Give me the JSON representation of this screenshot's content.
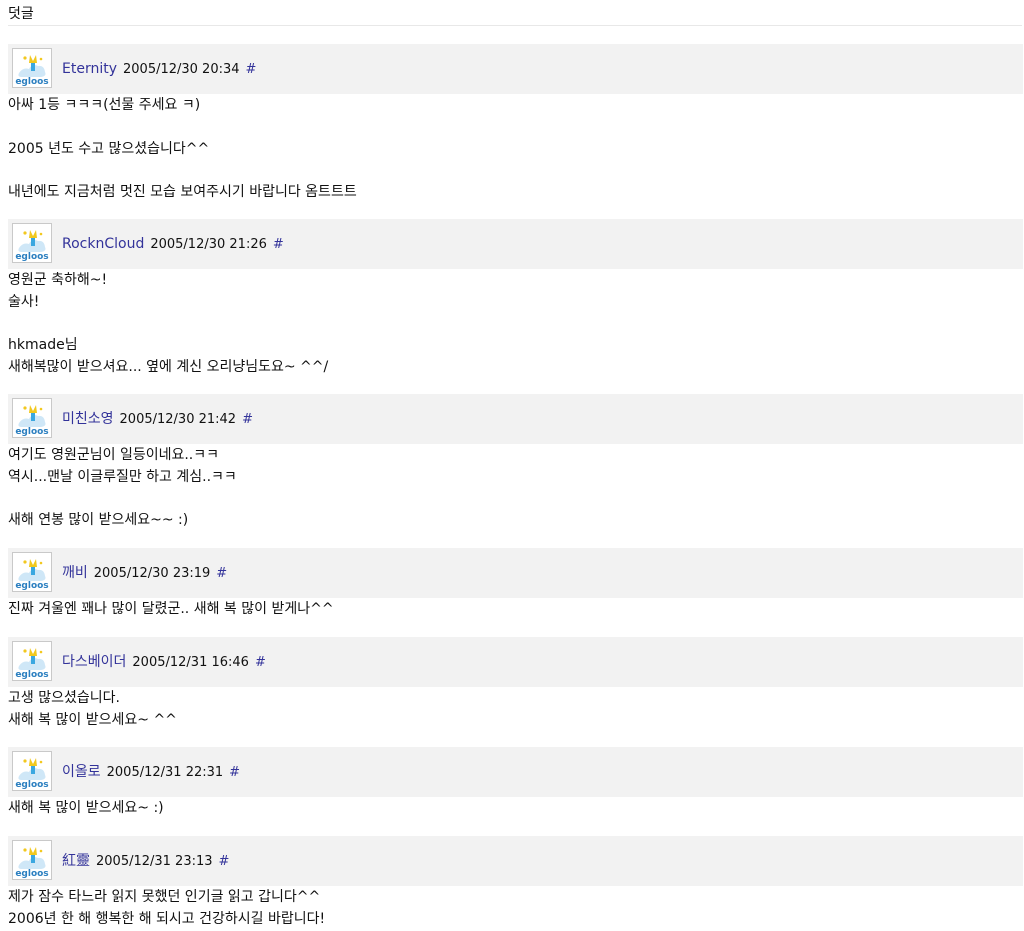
{
  "section_title": "덧글",
  "avatar_text": "egloos",
  "permalink_symbol": "#",
  "comments": [
    {
      "author": "Eternity",
      "timestamp": "2005/12/30 20:34",
      "lines": [
        "아싸 1등 ㅋㅋㅋ(선물 주세요 ㅋ)",
        "",
        "2005 년도 수고 많으셨습니다^^",
        "",
        "내년에도 지금처럼 멋진 모습 보여주시기 바랍니다 옴트트트"
      ]
    },
    {
      "author": "RocknCloud",
      "timestamp": "2005/12/30 21:26",
      "lines": [
        "영원군 축하해~!",
        "술사!",
        "",
        "hkmade님",
        "새해복많이 받으셔요... 옆에 계신 오리냥님도요~ ^^/"
      ]
    },
    {
      "author": "미친소영",
      "timestamp": "2005/12/30 21:42",
      "lines": [
        "여기도 영원군님이 일등이네요..ㅋㅋ",
        "역시...맨날 이글루질만 하고 계심..ㅋㅋ",
        "",
        "새해 연봉 많이 받으세요~~ :)"
      ]
    },
    {
      "author": "깨비",
      "timestamp": "2005/12/30 23:19",
      "lines": [
        "진짜 겨울엔 꽤나 많이 달렸군.. 새해 복 많이 받게나^^"
      ]
    },
    {
      "author": "다스베이더",
      "timestamp": "2005/12/31 16:46",
      "lines": [
        "고생 많으셨습니다.",
        "새해 복 많이 받으세요~ ^^"
      ]
    },
    {
      "author": "이올로",
      "timestamp": "2005/12/31 22:31",
      "lines": [
        "새해 복 많이 받으세요~ :)"
      ]
    },
    {
      "author": "紅靈",
      "timestamp": "2005/12/31 23:13",
      "lines": [
        "제가 잠수 타느라 읽지 못했던 인기글 읽고 갑니다^^",
        "2006년 한 해 행복한 해 되시고 건강하시길 바랍니다!"
      ]
    }
  ]
}
